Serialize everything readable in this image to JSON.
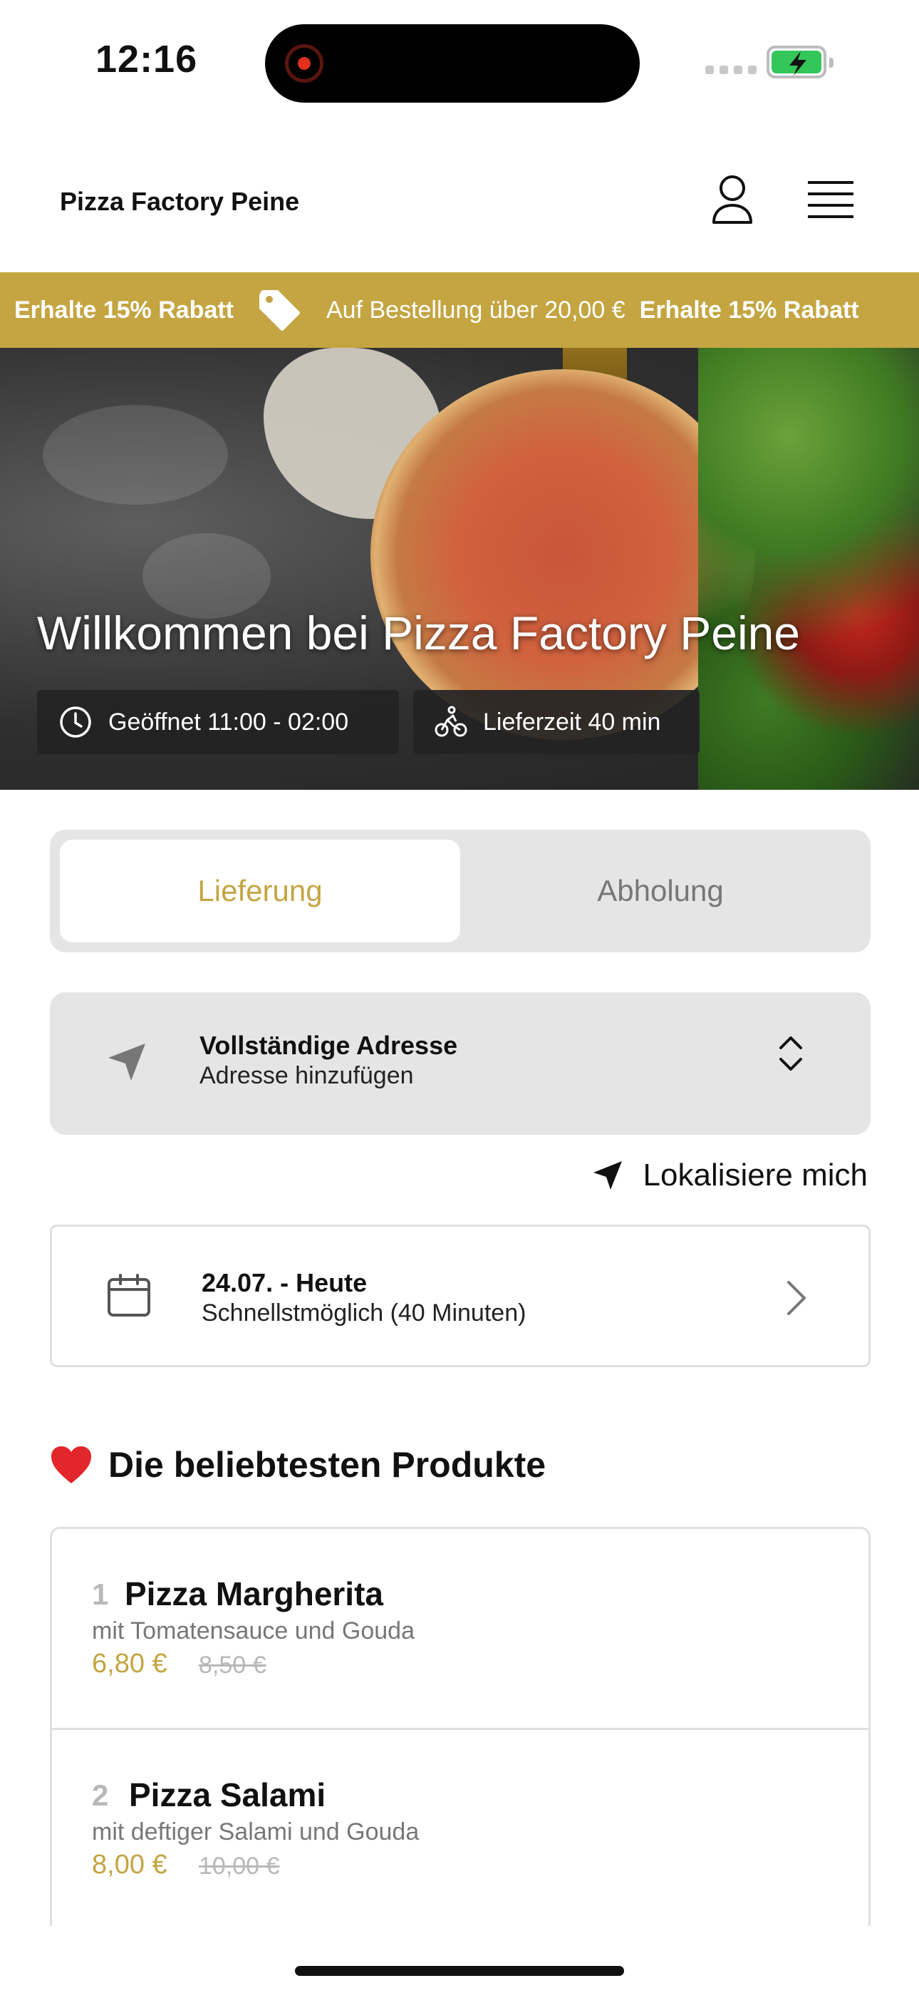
{
  "status_bar": {
    "time": "12:16"
  },
  "header": {
    "brand": "Pizza Factory Peine"
  },
  "promo": {
    "bold_text": "Erhalte 15% Rabatt",
    "light_text": "Auf Bestellung über 20,00 €",
    "bold_text_repeat": "Erhalte 15% Rabatt"
  },
  "hero": {
    "title": "Willkommen bei Pizza Factory Peine",
    "open_hours": "Geöffnet 11:00 - 02:00",
    "delivery_time": "Lieferzeit 40 min"
  },
  "mode_toggle": {
    "delivery_label": "Lieferung",
    "pickup_label": "Abholung",
    "selected": "Lieferung"
  },
  "address": {
    "title": "Vollständige Adresse",
    "subtitle": "Adresse hinzufügen"
  },
  "locate": {
    "label": "Lokalisiere mich"
  },
  "schedule": {
    "date": "24.07. - Heute",
    "time": "Schnellstmöglich (40 Minuten)"
  },
  "popular": {
    "title": "Die beliebtesten Produkte",
    "items": [
      {
        "rank": "1",
        "name": "Pizza Margherita",
        "description": "mit Tomatensauce und Gouda",
        "price": "6,80 €",
        "old_price": "8,50 €"
      },
      {
        "rank": "2",
        "name": "Pizza Salami",
        "description": "mit deftiger Salami und Gouda",
        "price": "8,00 €",
        "old_price": "10,00 €"
      }
    ]
  },
  "colors": {
    "accent": "#c4a542",
    "card_gray": "#e5e5e5",
    "muted": "#777777"
  }
}
